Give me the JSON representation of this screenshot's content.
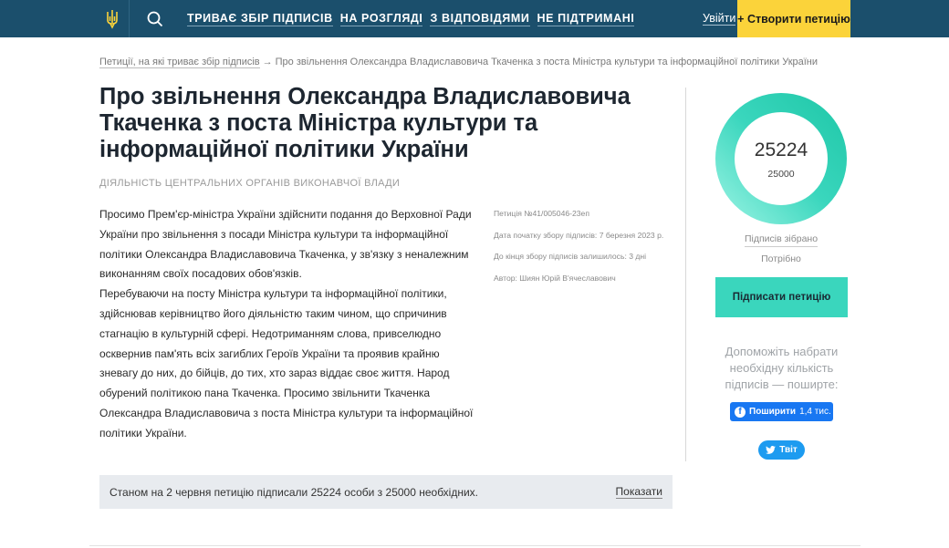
{
  "header": {
    "nav": [
      {
        "label": "ТРИВАЄ ЗБІР ПІДПИСІВ"
      },
      {
        "label": "НА РОЗГЛЯДІ"
      },
      {
        "label": "З ВІДПОВІДЯМИ"
      },
      {
        "label": "НЕ ПІДТРИМАНІ"
      }
    ],
    "login_label": "Увійти",
    "create_label": "+ Створити петицію"
  },
  "breadcrumb": {
    "parent": "Петиції, на які триває збір підписів",
    "current": "Про звільнення Олександра Владиславовича Ткаченка з поста Міністра культури та інформаційної політики України"
  },
  "petition": {
    "title": "Про звільнення Олександра Владиславовича Ткаченка з поста Міністра культури та інформаційної політики України",
    "category": "ДІЯЛЬНІСТЬ ЦЕНТРАЛЬНИХ ОРГАНІВ ВИКОНАВЧОЇ ВЛАДИ",
    "paragraphs": [
      "Просимо Прем'єр-міністра України здійснити подання до Верховної Ради України про звільнення з посади Міністра культури та інформаційної політики Олександра Владиславовича Ткаченка, у зв'язку з неналежним виконанням своїх посадових обов'язків.",
      "Перебуваючи на посту Міністра культури та інформаційної політики, здійснював керівництво його діяльністю таким чином, що спричинив стагнацію в культурній сфері. Недотриманням слова, привселюдно осквернив пам'ять всіх загиблих Героїв України та проявив крайню зневагу до них, до бійців, до тих, хто зараз віддає своє життя. Народ обурений політикою пана Ткаченка. Просимо звільнити Ткаченка Олександра Владиславовича з поста Міністра культури та інформаційної політики України."
    ],
    "meta": {
      "number": "Петиція №41/005046-23еп",
      "start_date": "Дата початку збору підписів: 7 березня 2023 р.",
      "remaining": "До кінця збору підписів залишилось: 3 дні",
      "author": "Автор: Шиян Юрій В'ячеславович"
    },
    "status_text": "Станом на 2 червня петицію підписали 25224 особи з 25000 необхідних.",
    "show_label": "Показати"
  },
  "progress": {
    "signatures": "25224",
    "target": "25000",
    "fraction": 1.0,
    "collected_label": "Підписів зібрано",
    "needed_label": "Потрібно",
    "sign_label": "Підписати петицію",
    "help_text": "Допоможіть набрати необхідну кількість підписів — поширте:",
    "share_fb_label": "Поширити",
    "share_fb_count": "1,4 тис.",
    "share_tw_label": "Твіт"
  },
  "colors": {
    "header_bg": "#1b4f6c",
    "create_bg": "#fbd33a",
    "accent": "#3ad6bd"
  }
}
